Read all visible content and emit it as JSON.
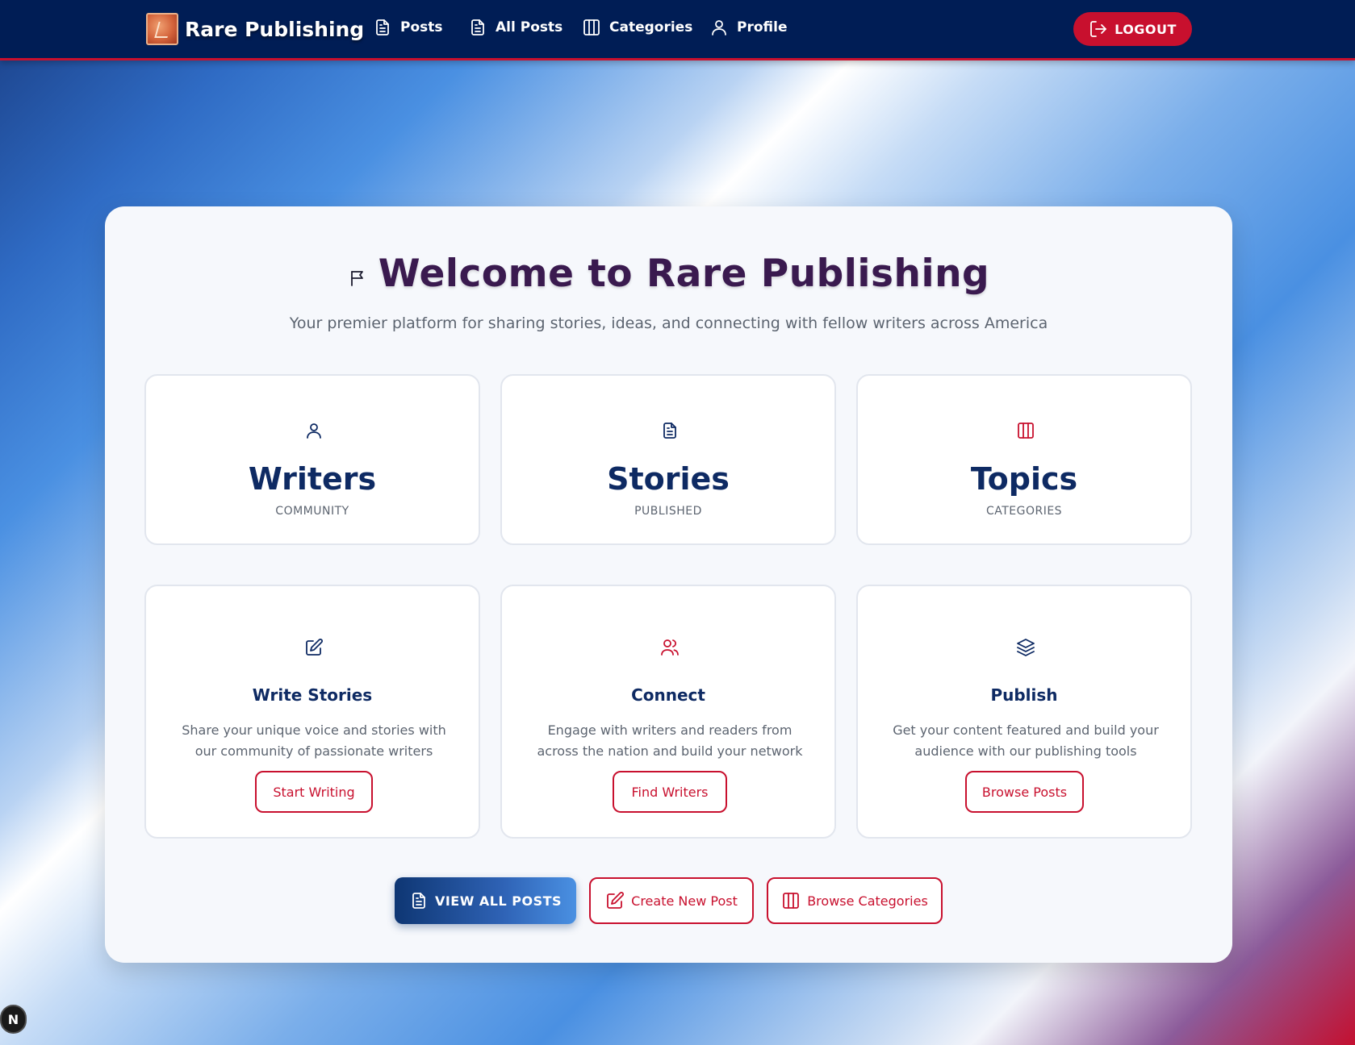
{
  "navbar": {
    "brand": "Rare Publishing",
    "items": [
      {
        "label": "Posts",
        "icon": "document-icon"
      },
      {
        "label": "All Posts",
        "icon": "document-icon"
      },
      {
        "label": "Categories",
        "icon": "columns-icon"
      },
      {
        "label": "Profile",
        "icon": "user-icon"
      }
    ],
    "logout_label": "LOGOUT"
  },
  "hero": {
    "title": "Welcome to Rare Publishing",
    "subtitle": "Your premier platform for sharing stories, ideas, and connecting with fellow writers across America",
    "icon": "flag-icon"
  },
  "stats": [
    {
      "title": "Writers",
      "label": "COMMUNITY",
      "icon": "user-icon"
    },
    {
      "title": "Stories",
      "label": "PUBLISHED",
      "icon": "document-icon"
    },
    {
      "title": "Topics",
      "label": "CATEGORIES",
      "icon": "columns-icon"
    }
  ],
  "features": [
    {
      "title": "Write Stories",
      "description": "Share your unique voice and stories with our community of passionate writers",
      "button": "Start Writing",
      "icon": "edit-icon"
    },
    {
      "title": "Connect",
      "description": "Engage with writers and readers from across the nation and build your network",
      "button": "Find Writers",
      "icon": "users-icon"
    },
    {
      "title": "Publish",
      "description": "Get your content featured and build your audience with our publishing tools",
      "button": "Browse Posts",
      "icon": "layers-icon"
    }
  ],
  "actions": {
    "view_all": "VIEW ALL POSTS",
    "create": "Create New Post",
    "browse": "Browse Categories"
  },
  "colors": {
    "navy": "#001d55",
    "red": "#c8102e",
    "blue": "#4a90e2",
    "title_dark": "#0e2a63"
  },
  "dev_badge": "N"
}
